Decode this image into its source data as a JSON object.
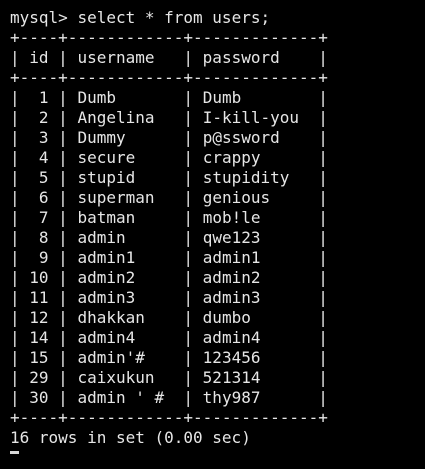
{
  "terminal": {
    "prompt": "mysql> ",
    "command": "select * from users;",
    "border": "+----+------------+-------------+",
    "header": {
      "id": "id",
      "username": "username",
      "password": "password"
    },
    "rows": [
      {
        "id": "1",
        "username": "Dumb",
        "password": "Dumb"
      },
      {
        "id": "2",
        "username": "Angelina",
        "password": "I-kill-you"
      },
      {
        "id": "3",
        "username": "Dummy",
        "password": "p@ssword"
      },
      {
        "id": "4",
        "username": "secure",
        "password": "crappy"
      },
      {
        "id": "5",
        "username": "stupid",
        "password": "stupidity"
      },
      {
        "id": "6",
        "username": "superman",
        "password": "genious"
      },
      {
        "id": "7",
        "username": "batman",
        "password": "mob!le"
      },
      {
        "id": "8",
        "username": "admin",
        "password": "qwe123"
      },
      {
        "id": "9",
        "username": "admin1",
        "password": "admin1"
      },
      {
        "id": "10",
        "username": "admin2",
        "password": "admin2"
      },
      {
        "id": "11",
        "username": "admin3",
        "password": "admin3"
      },
      {
        "id": "12",
        "username": "dhakkan",
        "password": "dumbo"
      },
      {
        "id": "14",
        "username": "admin4",
        "password": "admin4"
      },
      {
        "id": "15",
        "username": "admin'#",
        "password": "123456"
      },
      {
        "id": "29",
        "username": "caixukun",
        "password": "521314"
      },
      {
        "id": "30",
        "username": "admin ' #",
        "password": "thy987"
      }
    ],
    "summary": "16 rows in set (0.00 sec)"
  }
}
